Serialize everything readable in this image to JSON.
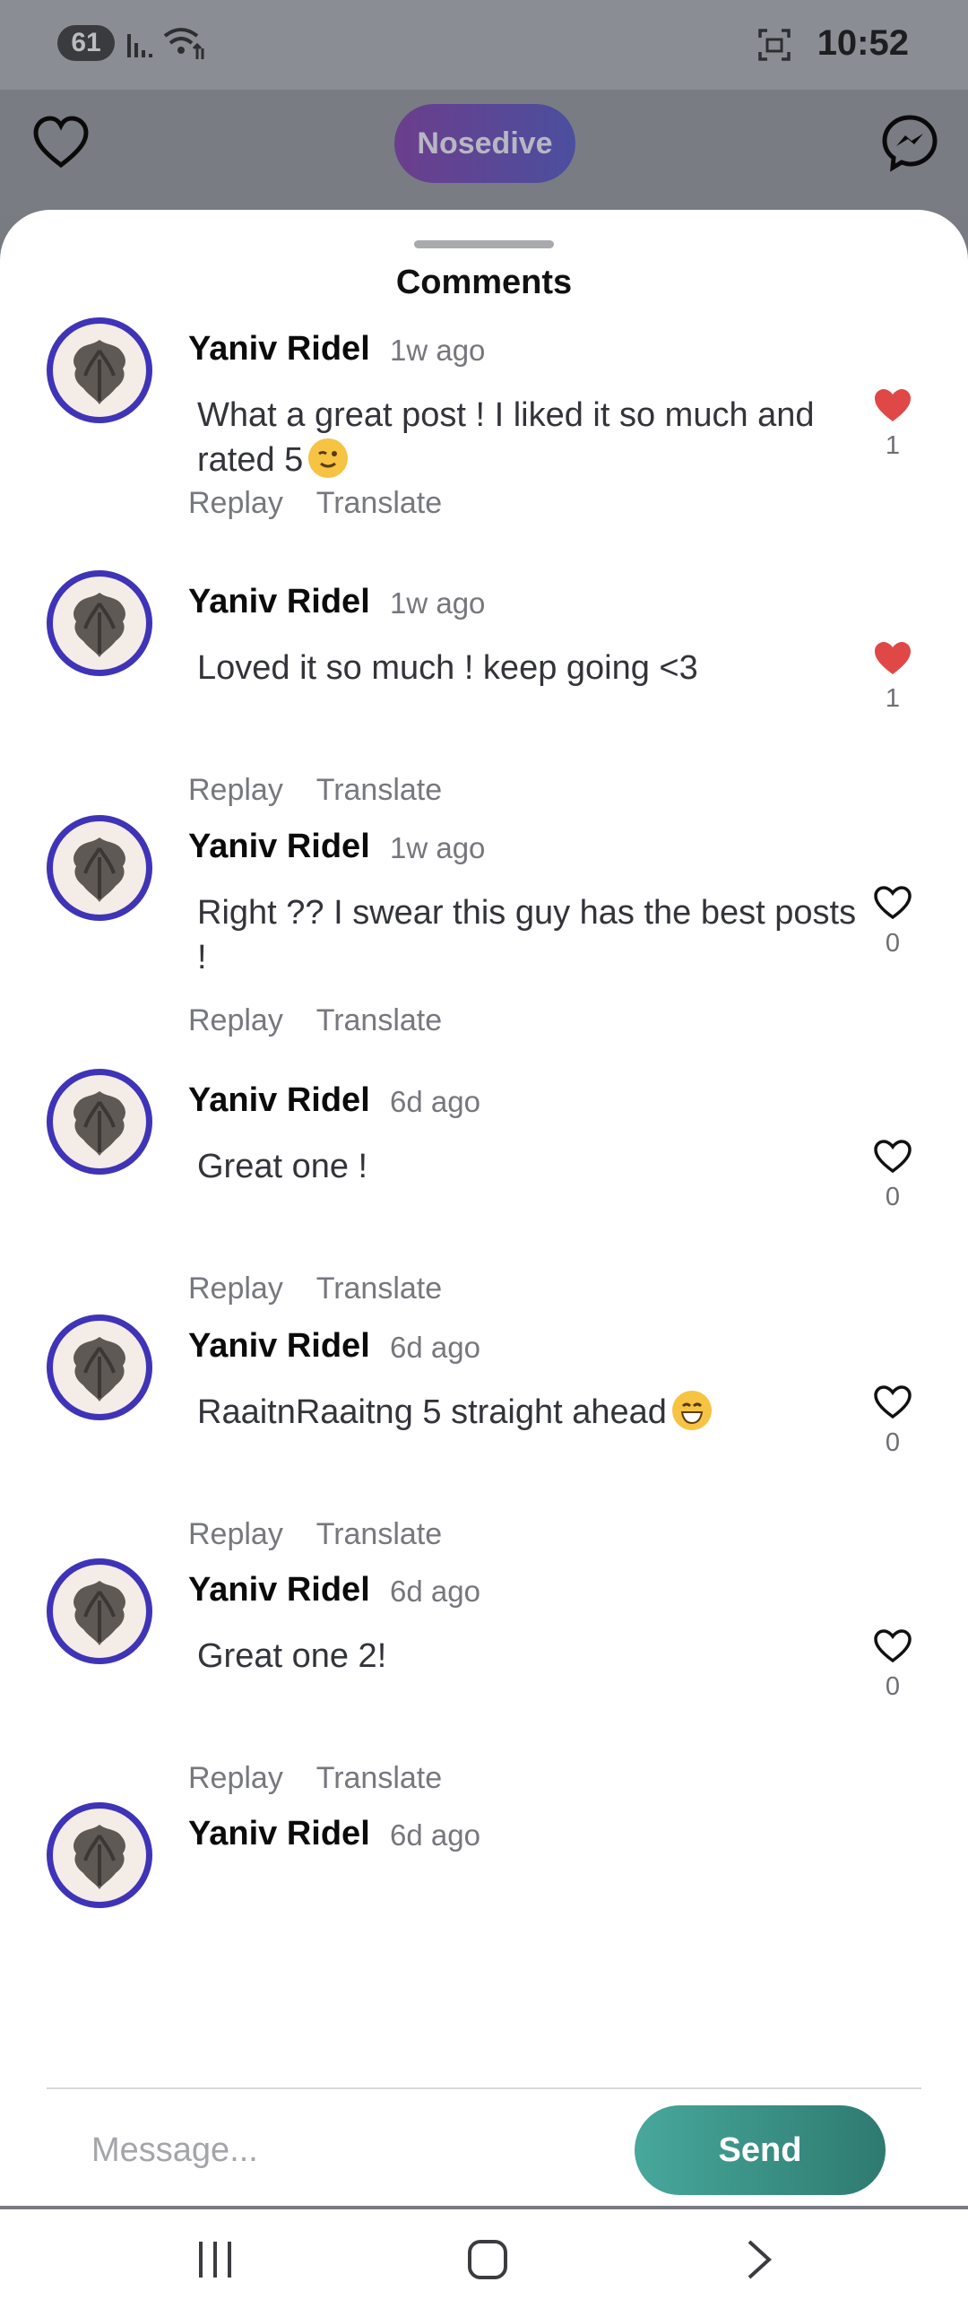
{
  "status": {
    "battery": "61",
    "time": "10:52"
  },
  "header": {
    "app_label": "Nosedive"
  },
  "sheet": {
    "title": "Comments"
  },
  "comments": [
    {
      "user": "Yaniv Ridel",
      "ago": "1w ago",
      "text": "What a great post ! I liked it so much and rated 5",
      "emoji": "wink",
      "liked": true,
      "likes": "1"
    },
    {
      "user": "Yaniv Ridel",
      "ago": "1w ago",
      "text": "Loved it so much ! keep going <3",
      "liked": true,
      "likes": "1"
    },
    {
      "user": "Yaniv Ridel",
      "ago": "1w ago",
      "text": "Right ?? I swear this guy has the best posts !",
      "liked": false,
      "likes": "0"
    },
    {
      "user": "Yaniv Ridel",
      "ago": "6d ago",
      "text": "Great one !",
      "liked": false,
      "likes": "0"
    },
    {
      "user": "Yaniv Ridel",
      "ago": "6d ago",
      "text": "RaaitnRaaitng 5 straight ahead",
      "emoji": "grin",
      "liked": false,
      "likes": "0"
    },
    {
      "user": "Yaniv Ridel",
      "ago": "6d ago",
      "text": "Great one 2!",
      "liked": false,
      "likes": "0"
    },
    {
      "user": "Yaniv Ridel",
      "ago": "6d ago",
      "text": "",
      "liked": false,
      "likes": ""
    }
  ],
  "actions": {
    "reply": "Replay",
    "translate": "Translate"
  },
  "composer": {
    "placeholder": "Message...",
    "send_label": "Send"
  },
  "colors": {
    "accent": "#3f33b8",
    "like_red": "#e04848",
    "send_start": "#47a89b",
    "send_end": "#2e7a70"
  },
  "icons": [
    "heart-outline-icon",
    "messenger-icon",
    "heart-filled-icon",
    "recents-nav-icon",
    "home-nav-icon",
    "back-nav-icon"
  ]
}
